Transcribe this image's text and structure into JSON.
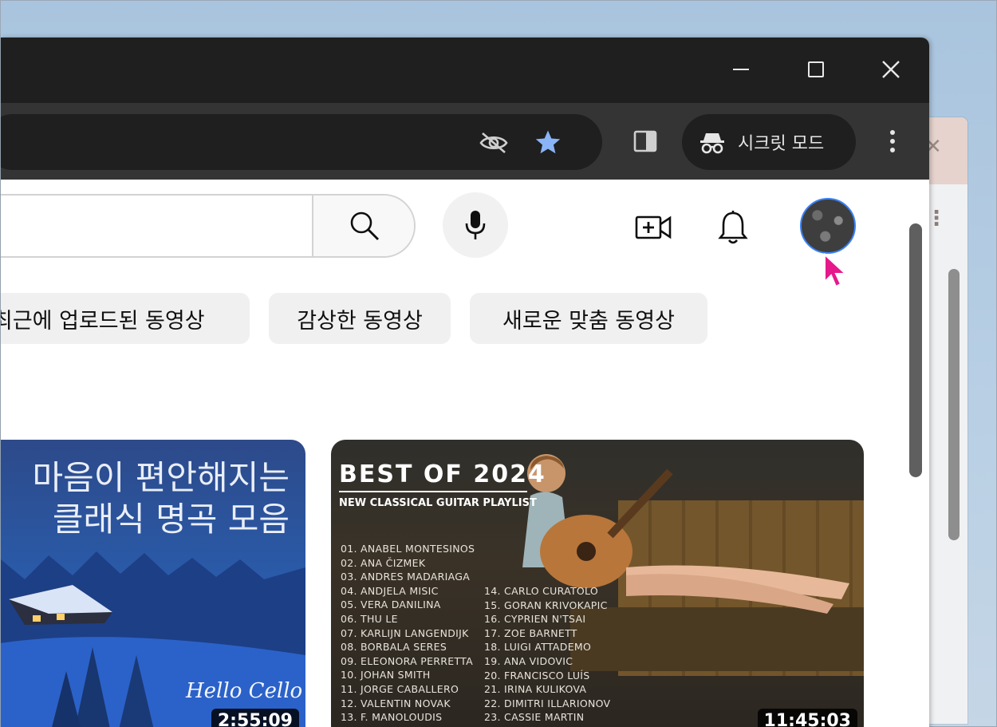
{
  "window": {
    "controls": [
      "minimize",
      "maximize",
      "close"
    ]
  },
  "toolbar": {
    "incognito_label": "시크릿 모드",
    "icons": [
      "eye-off-icon",
      "star-icon",
      "side-panel-icon",
      "more-vert-icon"
    ]
  },
  "header": {
    "search_placeholder": "",
    "icons": [
      "search-icon",
      "mic-icon",
      "create-video-icon",
      "notifications-bell-icon",
      "avatar"
    ]
  },
  "chips": [
    {
      "label": "최근에 업로드된 동영상"
    },
    {
      "label": "감상한 동영상"
    },
    {
      "label": "새로운 맞춤 동영상"
    }
  ],
  "videos": [
    {
      "thumbnail_title_line1": "마음이 편안해지는",
      "thumbnail_title_line2": "클래식 명곡 모음",
      "thumbnail_signature": "Hello Cello",
      "duration": "2:55:09"
    },
    {
      "thumbnail_heading": "BEST OF 2024",
      "thumbnail_subheading": "NEW CLASSICAL GUITAR PLAYLIST",
      "tracklist_col1": [
        "01. ANABEL MONTESINOS",
        "02. ANA ČIZMEK",
        "03. ANDRES MADARIAGA",
        "04. ANDJELA MISIC",
        "05. VERA DANILINA",
        "06. THU LE",
        "07. KARLIJN LANGENDIJK",
        "08. BORBALA SERES",
        "09. ELEONORA PERRETTA",
        "10. JOHAN SMITH",
        "11. JORGE CABALLERO",
        "12. VALENTIN NOVAK",
        "13. F. MANOLOUDIS"
      ],
      "tracklist_col2": [
        "14. CARLO CURATOLO",
        "15. GORAN KRIVOKAPIC",
        "16. CYPRIEN N'TSAI",
        "17. ZOE BARNETT",
        "18. LUIGI ATTADEMO",
        "19. ANA VIDOVIC",
        "20. FRANCISCO LUÍS",
        "21. IRINA KULIKOVA",
        "22. DIMITRI ILLARIONOV",
        "23. CASSIE MARTIN"
      ],
      "duration": "11:45:03"
    }
  ]
}
